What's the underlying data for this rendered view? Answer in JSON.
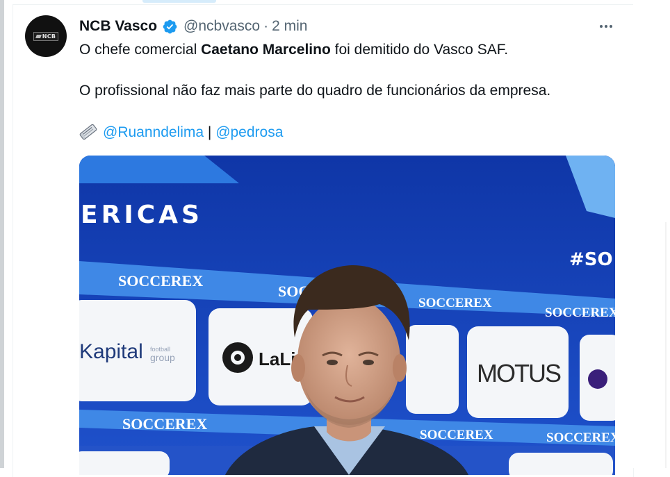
{
  "tweet": {
    "display_name": "NCB Vasco",
    "handle": "@ncbvasco",
    "separator": "·",
    "time": "2 min",
    "avatar_text": "NCB",
    "line1": {
      "pre": "O chefe comercial ",
      "bold": "Caetano Marcelino",
      "post": " foi demitido do Vasco SAF."
    },
    "line2": "O profissional não faz mais parte do quadro de funcionários da empresa.",
    "line3": {
      "mention1": "@Ruanndelima",
      "divider": " | ",
      "mention2": "@pedrosa"
    }
  },
  "media": {
    "backdrop_text": {
      "top_word": "ERICAS",
      "hashtag": "#SO",
      "brand_repeat": "SOCCEREX",
      "sponsor_capital": "Kapital",
      "sponsor_capital_sub1": "football",
      "sponsor_capital_sub2": "group",
      "sponsor_laliga": "LaLi",
      "sponsor_motus": "MOTUS"
    }
  },
  "colors": {
    "accent": "#1d9bf0",
    "text_primary": "#0f1419",
    "text_secondary": "#536471",
    "backdrop_blue": "#1a43b8"
  },
  "icons": [
    "verified-badge-icon",
    "more-options-icon",
    "newspaper-icon"
  ]
}
